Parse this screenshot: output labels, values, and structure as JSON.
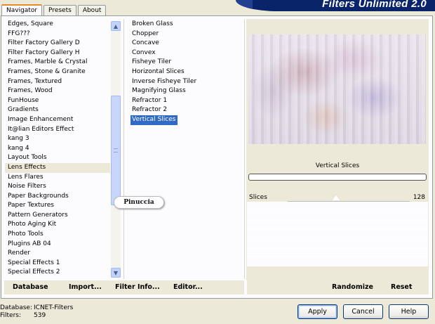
{
  "app": {
    "title": "Filters Unlimited 2.0"
  },
  "tabs": [
    {
      "label": "Navigator",
      "active": true
    },
    {
      "label": "Presets",
      "active": false
    },
    {
      "label": "About",
      "active": false
    }
  ],
  "categories": {
    "selected": "Lens Effects",
    "items": [
      "Edges, Square",
      "FFG???",
      "Filter Factory Gallery D",
      "Filter Factory Gallery H",
      "Frames, Marble & Crystal",
      "Frames, Stone & Granite",
      "Frames, Textured",
      "Frames, Wood",
      "FunHouse",
      "Gradients",
      "Image Enhancement",
      "It@lian Editors Effect",
      "kang 3",
      "kang 4",
      "Layout Tools",
      "Lens Effects",
      "Lens Flares",
      "Noise Filters",
      "Paper Backgrounds",
      "Paper Textures",
      "Pattern Generators",
      "Photo Aging Kit",
      "Photo Tools",
      "Plugins AB 04",
      "Render",
      "Special Effects 1",
      "Special Effects 2"
    ]
  },
  "filters": {
    "selected": "Vertical Slices",
    "items": [
      "Broken Glass",
      "Chopper",
      "Concave",
      "Convex",
      "Fisheye Tiler",
      "Horizontal Slices",
      "Inverse Fisheye Tiler",
      "Magnifying Glass",
      "Refractor 1",
      "Refractor 2",
      "Vertical Slices"
    ]
  },
  "watermark": "Pinuccia",
  "preview": {
    "filter_name": "Vertical Slices"
  },
  "params": [
    {
      "label": "Slices",
      "value": "128"
    }
  ],
  "toolbar": {
    "database": "Database",
    "import": "Import...",
    "filter_info": "Filter Info...",
    "editor": "Editor...",
    "randomize": "Randomize",
    "reset": "Reset"
  },
  "status": {
    "database_label": "Database:",
    "database_value": "ICNET-Filters",
    "filters_label": "Filters:",
    "filters_value": "539"
  },
  "buttons": {
    "apply": "Apply",
    "cancel": "Cancel",
    "help": "Help"
  },
  "colors": {
    "selection": "#316ac5",
    "banner": "#0a246a",
    "tab_accent": "#e68b2c"
  }
}
